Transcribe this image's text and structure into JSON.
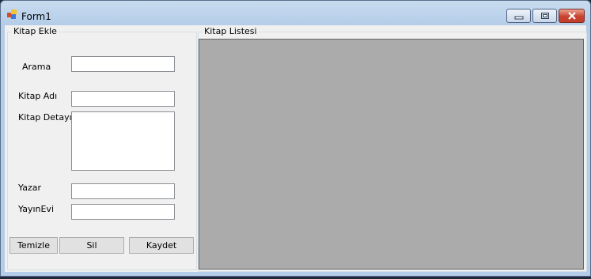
{
  "window": {
    "title": "Form1",
    "icon": "app-form-icon",
    "controls": [
      "minimize-icon",
      "maximize-icon",
      "close-icon"
    ]
  },
  "add_group": {
    "title": "Kitap Ekle",
    "search_label": "Arama",
    "search_value": "",
    "book_name_label": "Kitap Adı",
    "book_name_value": "",
    "book_detail_label": "Kitap Detayı",
    "book_detail_value": "",
    "author_label": "Yazar",
    "author_value": "",
    "publisher_label": "YayınEvi",
    "publisher_value": "",
    "buttons": {
      "clear": "Temizle",
      "delete": "Sil",
      "save": "Kaydet"
    }
  },
  "list_group": {
    "title": "Kitap Listesi",
    "grid_background": "#ababab"
  }
}
